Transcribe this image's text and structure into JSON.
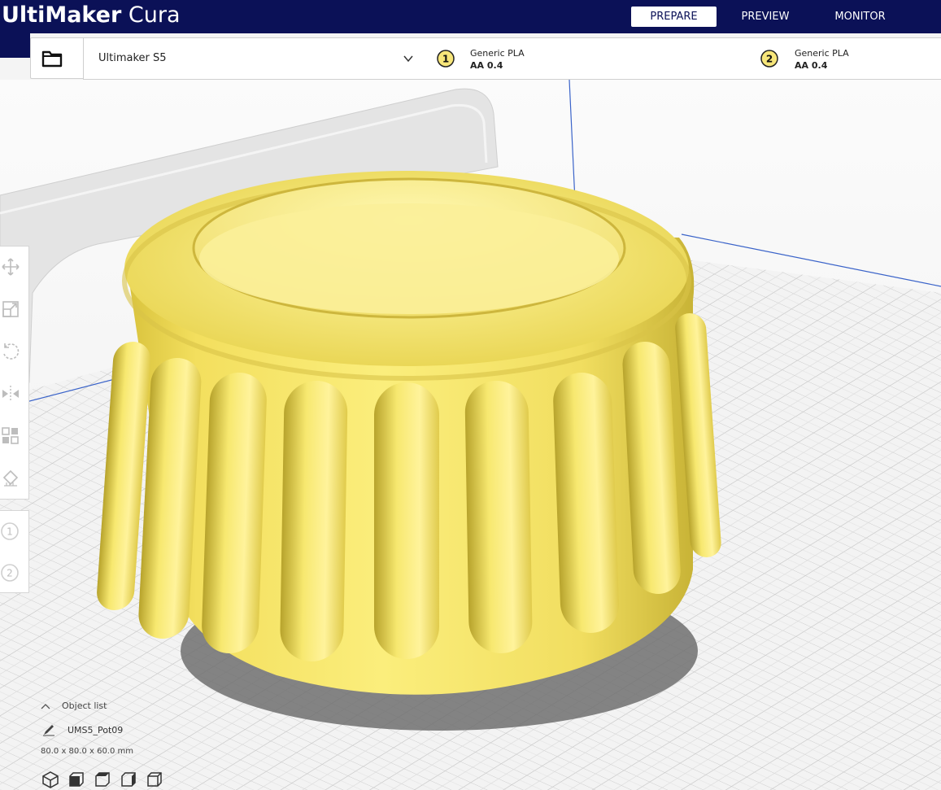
{
  "app": {
    "brand_bold": "UltiMaker",
    "brand_light": " Cura"
  },
  "stages": [
    {
      "label": "PREPARE",
      "active": true
    },
    {
      "label": "PREVIEW",
      "active": false
    },
    {
      "label": "MONITOR",
      "active": false
    }
  ],
  "printer": {
    "name": "Ultimaker S5"
  },
  "extruders": [
    {
      "number": "1",
      "material": "Generic PLA",
      "nozzle": "AA 0.4"
    },
    {
      "number": "2",
      "material": "Generic PLA",
      "nozzle": "AA 0.4"
    }
  ],
  "toolbar": {
    "tools": [
      "move-icon",
      "scale-icon",
      "rotate-icon",
      "mirror-icon",
      "per-model-settings-icon",
      "support-blocker-icon"
    ],
    "extruder_buttons": [
      "1",
      "2"
    ]
  },
  "object_list": {
    "header": "Object list",
    "object_name": "UMS5_Pot09",
    "dimensions": "80.0 x 80.0 x 60.0 mm"
  },
  "view_buttons": [
    "3d-view-icon",
    "front-view-icon",
    "top-view-icon",
    "left-view-icon",
    "right-view-icon"
  ],
  "colors": {
    "header_bg": "#0b1157",
    "model_yellow": "#f8ea72",
    "model_shade": "#d4c23a",
    "build_plate": "#f2f2f2",
    "grid_line": "#c9c9c9"
  }
}
